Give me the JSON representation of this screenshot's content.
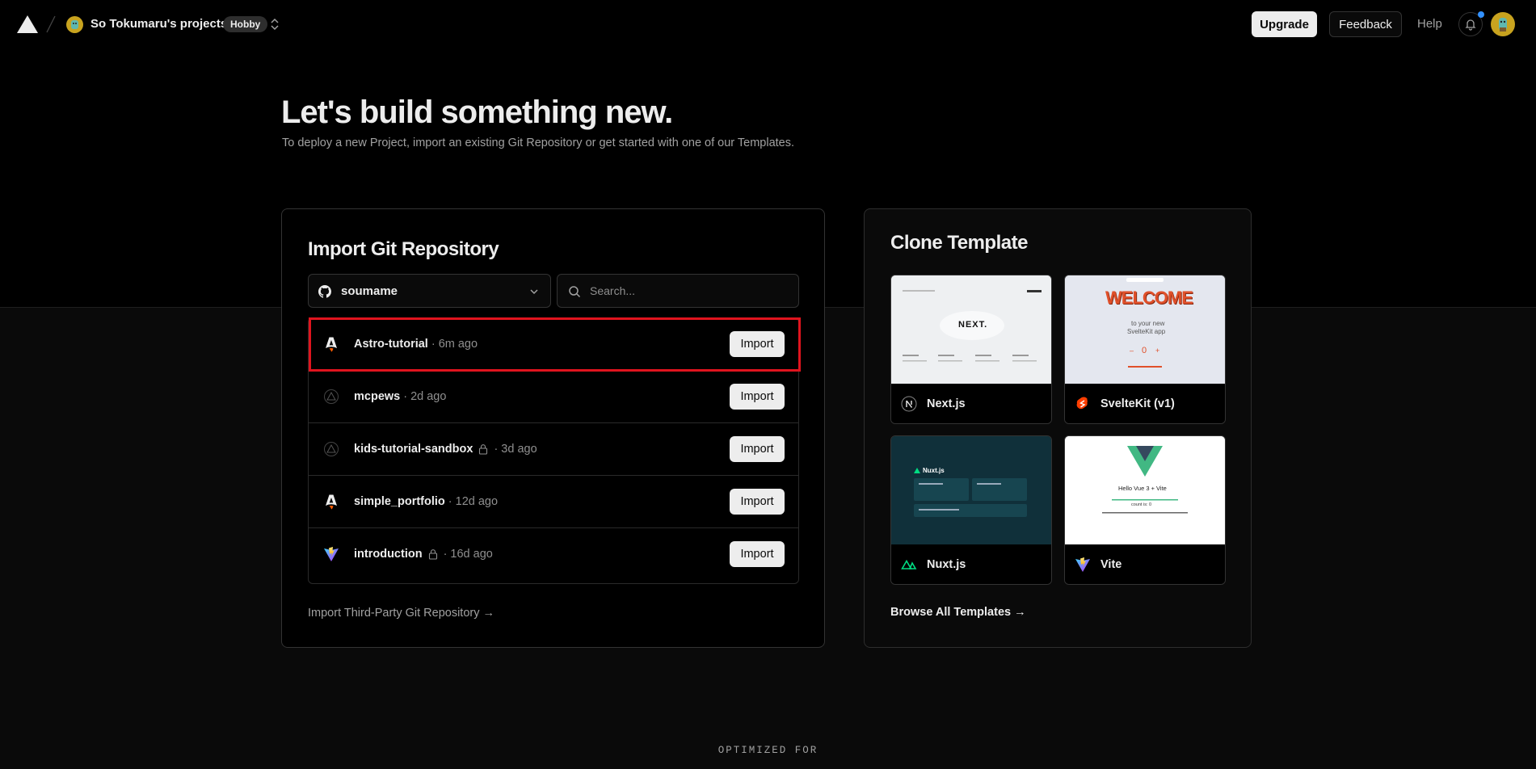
{
  "nav": {
    "team_name": "So Tokumaru's projects",
    "plan_badge": "Hobby",
    "upgrade_label": "Upgrade",
    "feedback_label": "Feedback",
    "help_label": "Help"
  },
  "hero": {
    "title": "Let's build something new.",
    "subtitle": "To deploy a new Project, import an existing Git Repository or get started with one of our Templates."
  },
  "import_card": {
    "title": "Import Git Repository",
    "account_select": {
      "value": "soumame",
      "icon": "github-icon"
    },
    "search": {
      "placeholder": "Search..."
    },
    "repos": [
      {
        "name": "Astro-tutorial",
        "private": false,
        "time": "6m ago",
        "icon": "astro-icon",
        "import_label": "Import"
      },
      {
        "name": "mcpews",
        "private": false,
        "time": "2d ago",
        "icon": "generic-repo-icon",
        "import_label": "Import"
      },
      {
        "name": "kids-tutorial-sandbox",
        "private": true,
        "time": "3d ago",
        "icon": "generic-repo-icon",
        "import_label": "Import"
      },
      {
        "name": "simple_portfolio",
        "private": false,
        "time": "12d ago",
        "icon": "astro-icon",
        "import_label": "Import"
      },
      {
        "name": "introduction",
        "private": true,
        "time": "16d ago",
        "icon": "vite-icon",
        "import_label": "Import"
      }
    ],
    "separator": "·",
    "third_party_link": "Import Third-Party Git Repository →"
  },
  "template_card": {
    "title": "Clone Template",
    "templates": [
      {
        "name": "Next.js",
        "icon": "nextjs-icon"
      },
      {
        "name": "SvelteKit (v1)",
        "icon": "svelte-icon"
      },
      {
        "name": "Nuxt.js",
        "icon": "nuxt-icon"
      },
      {
        "name": "Vite",
        "icon": "vite-icon"
      }
    ],
    "previews": {
      "nextjs_text": "NEXT.",
      "svelte_welcome": "WELCOME",
      "svelte_line1": "to your new",
      "svelte_line2": "SvelteKit app",
      "svelte_counter": "0",
      "nuxt_logo_text": "Nuxt.js",
      "vite_heading": "Hello Vue 3 + Vite",
      "vite_counter": "count is: 0"
    },
    "browse_all_link": "Browse All Templates →"
  },
  "footer": {
    "optimized_label": "OPTIMIZED FOR"
  },
  "colors": {
    "highlight": "#e0141e",
    "notification_dot": "#3291ff",
    "avatar": "#c8a31f"
  }
}
